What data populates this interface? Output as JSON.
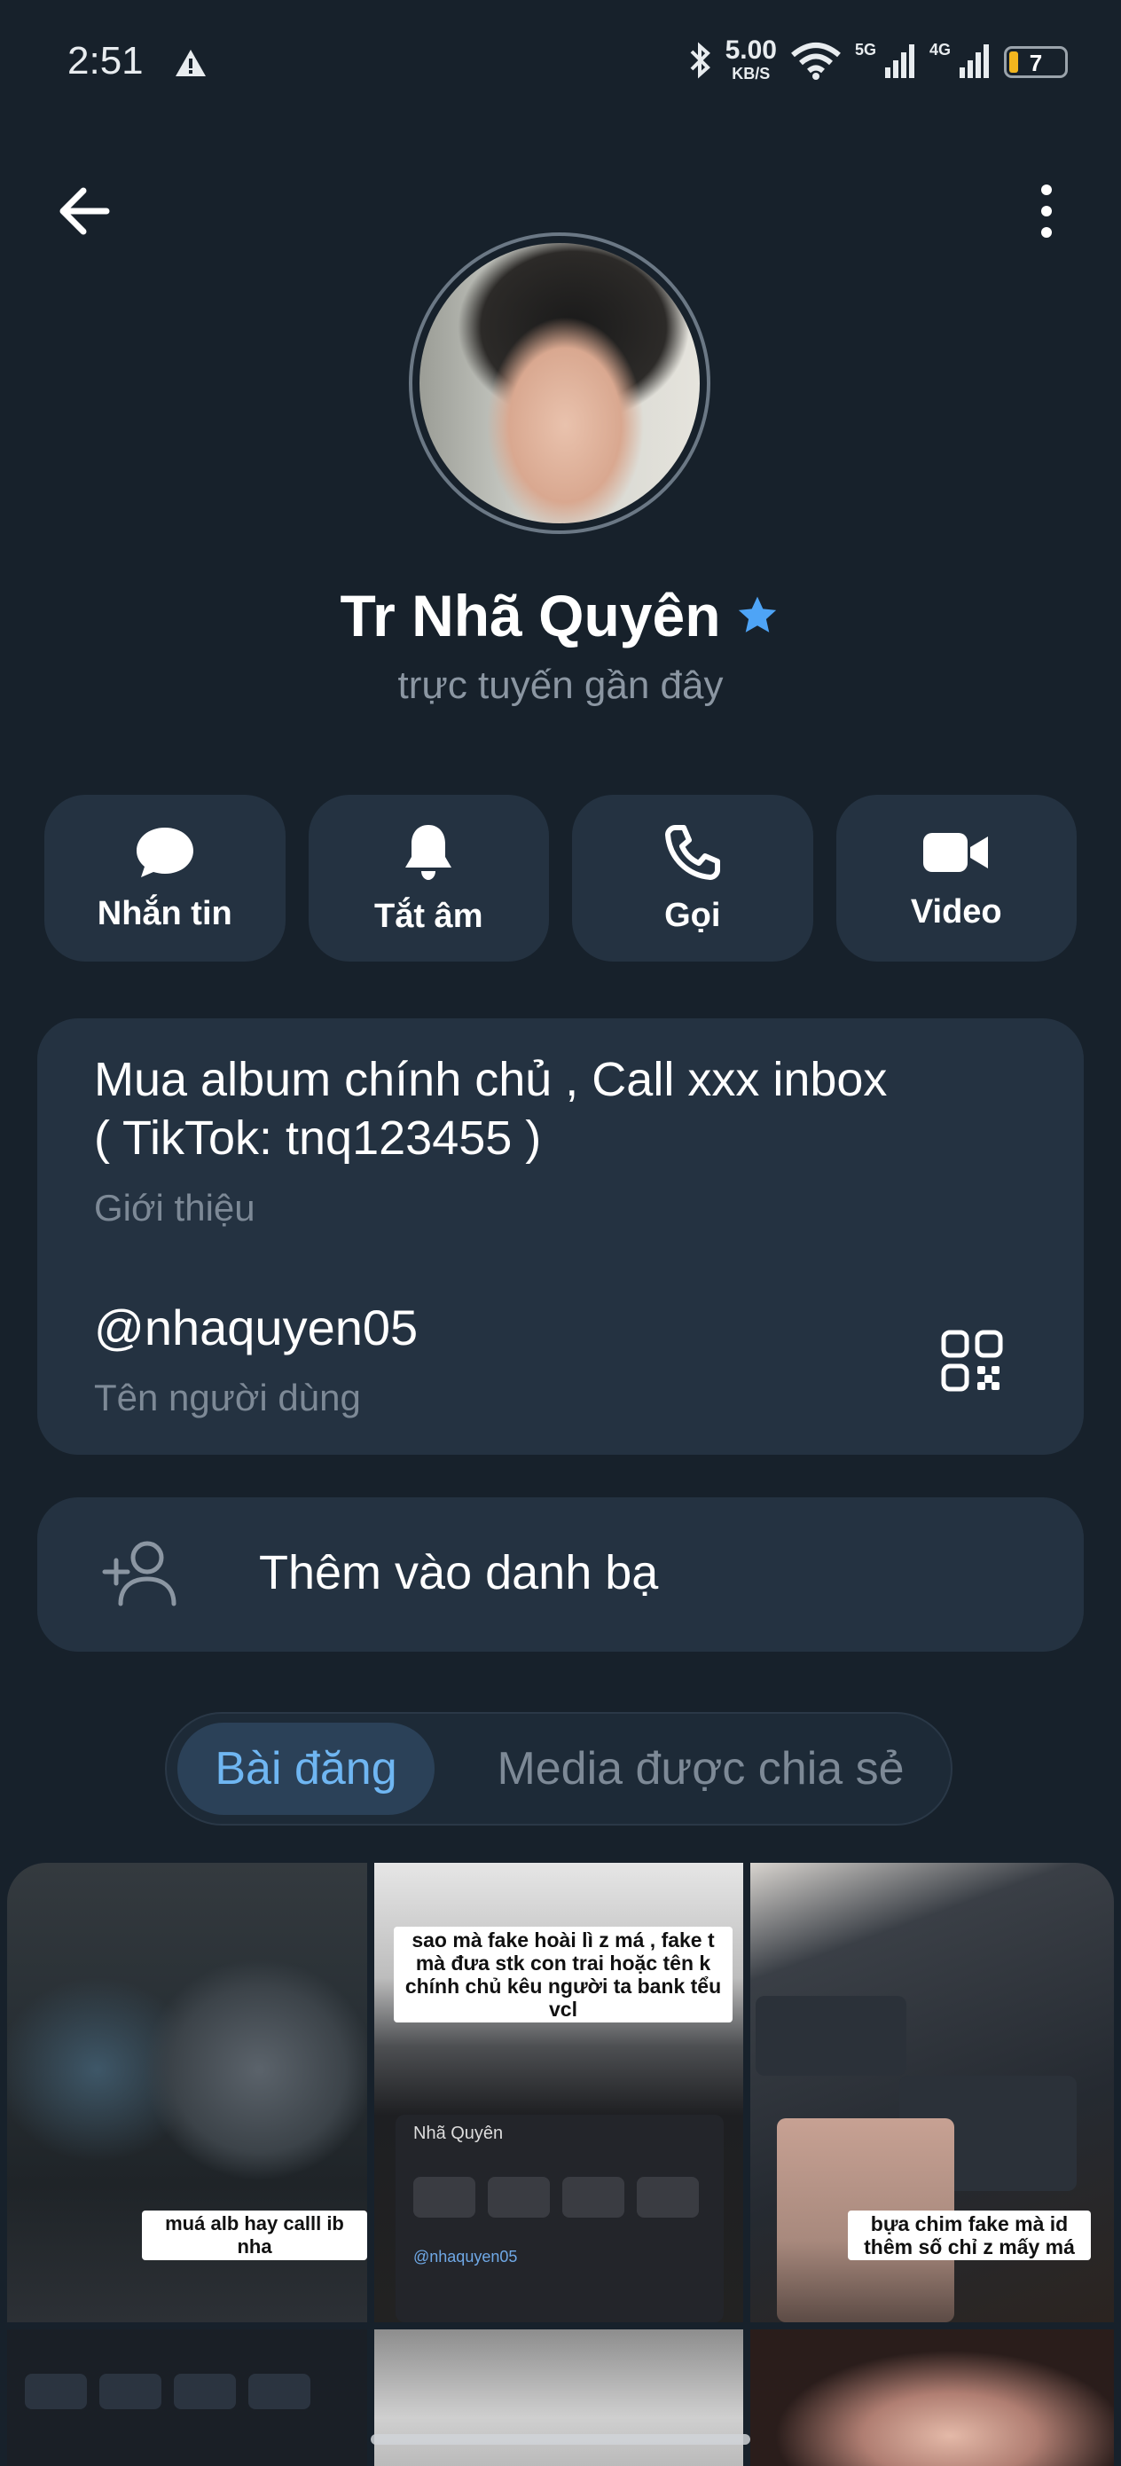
{
  "status_bar": {
    "time": "2:51",
    "speed_value": "5.00",
    "speed_unit": "KB/S",
    "net1": "5G",
    "net2": "4G",
    "battery": "7"
  },
  "profile": {
    "name": "Tr Nhã Quyên",
    "status": "trực tuyến gần đây"
  },
  "actions": [
    {
      "label": "Nhắn tin",
      "icon": "message-icon"
    },
    {
      "label": "Tắt âm",
      "icon": "bell-icon"
    },
    {
      "label": "Gọi",
      "icon": "phone-icon"
    },
    {
      "label": "Video",
      "icon": "video-icon"
    }
  ],
  "info": {
    "bio_line1": "Mua album chính chủ , Call xxx inbox",
    "bio_line2": "( TikTok: tnq123455 )",
    "bio_label": "Giới thiệu",
    "username": "@nhaquyen05",
    "username_label": "Tên người dùng"
  },
  "add_contact": {
    "label": "Thêm vào danh bạ"
  },
  "tabs": {
    "active": "Bài đăng",
    "inactive": "Media được chia sẻ"
  },
  "posts": {
    "caption1": "muá alb hay calll ib nha",
    "caption2": "sao mà fake hoài lì z má , fake t mà đưa stk con trai hoặc tên k chính chủ kêu người ta bank tểu vcl",
    "caption3": "bựa chim fake mà id thêm số chỉ z mấy má",
    "mini_name": "Nhã Quyên",
    "mini_username": "@nhaquyen05"
  },
  "colors": {
    "background": "#17212b",
    "card": "#243241",
    "accent": "#6fb6f2",
    "verified": "#4ea4f6"
  }
}
